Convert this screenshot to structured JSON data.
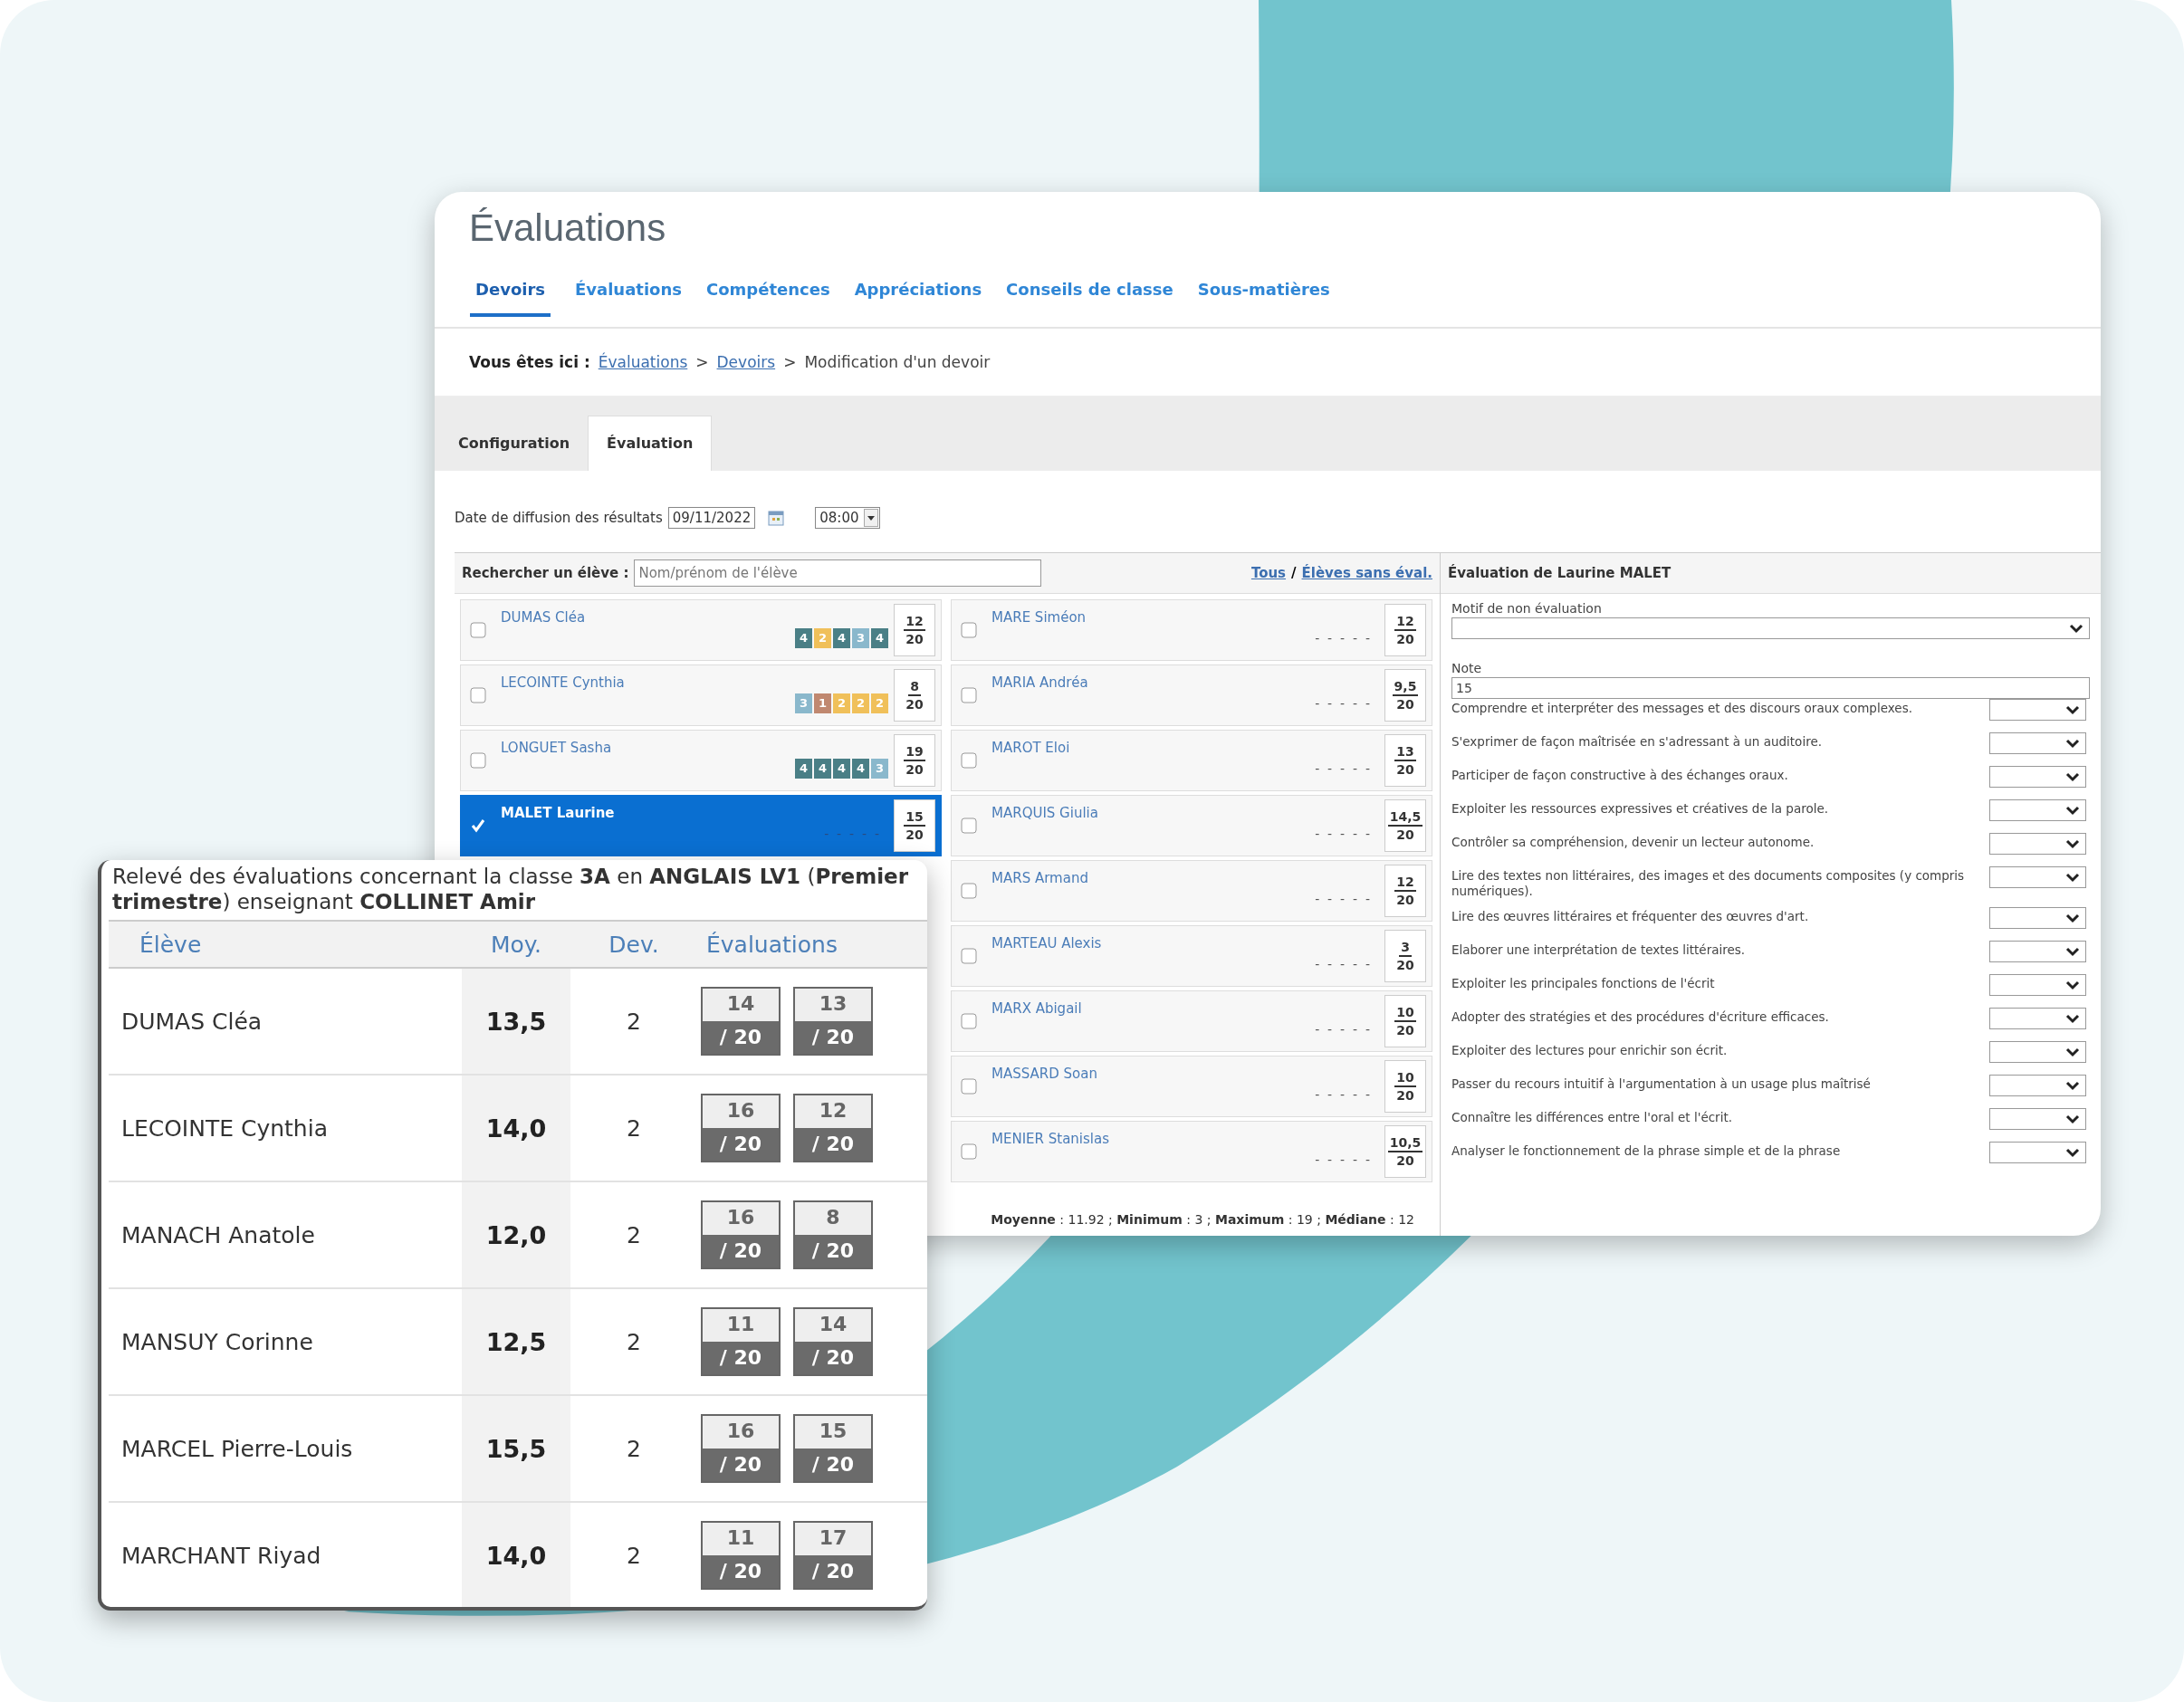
{
  "main_window": {
    "title": "Évaluations",
    "tabs": [
      {
        "label": "Devoirs",
        "selected": true
      },
      {
        "label": "Évaluations",
        "selected": false
      },
      {
        "label": "Compétences",
        "selected": false
      },
      {
        "label": "Appréciations",
        "selected": false
      },
      {
        "label": "Conseils de classe",
        "selected": false
      },
      {
        "label": "Sous-matières",
        "selected": false
      }
    ],
    "breadcrumb": {
      "label": "Vous êtes ici :",
      "items": [
        {
          "text": "Évaluations",
          "kind": "link"
        },
        {
          "text": ">",
          "kind": "separator"
        },
        {
          "text": "Devoirs",
          "kind": "link"
        },
        {
          "text": ">",
          "kind": "separator"
        },
        {
          "text": "Modification d'un devoir",
          "kind": "current"
        }
      ]
    },
    "subtabs": [
      {
        "label": "Configuration",
        "selected": false
      },
      {
        "label": "Évaluation",
        "selected": true
      }
    ],
    "date_row": {
      "label": "Date de diffusion des résultats",
      "date": "09/11/2022",
      "time": "08:00"
    },
    "search": {
      "label": "Rechercher un élève :",
      "placeholder": "Nom/prénom de l'élève",
      "filters": [
        "Tous",
        "Élèves sans éval."
      ],
      "filter_separator": "/"
    },
    "students_left": [
      {
        "name": "DUMAS Cléa",
        "checked": false,
        "selected": false,
        "skills": [
          {
            "value": "4",
            "color": "#4a7f86"
          },
          {
            "value": "2",
            "color": "#f0c05a"
          },
          {
            "value": "4",
            "color": "#4a7f86"
          },
          {
            "value": "3",
            "color": "#8ab8cc"
          },
          {
            "value": "4",
            "color": "#4a7f86"
          }
        ],
        "grade": "12",
        "total": "20"
      },
      {
        "name": "LECOINTE Cynthia",
        "checked": false,
        "selected": false,
        "skills": [
          {
            "value": "3",
            "color": "#8ab8cc"
          },
          {
            "value": "1",
            "color": "#c08870"
          },
          {
            "value": "2",
            "color": "#f0c05a"
          },
          {
            "value": "2",
            "color": "#f0c05a"
          },
          {
            "value": "2",
            "color": "#f0c05a"
          }
        ],
        "grade": "8",
        "total": "20"
      },
      {
        "name": "LONGUET Sasha",
        "checked": false,
        "selected": false,
        "skills": [
          {
            "value": "4",
            "color": "#4a7f86"
          },
          {
            "value": "4",
            "color": "#4a7f86"
          },
          {
            "value": "4",
            "color": "#4a7f86"
          },
          {
            "value": "4",
            "color": "#4a7f86"
          },
          {
            "value": "3",
            "color": "#8ab8cc"
          }
        ],
        "grade": "19",
        "total": "20"
      },
      {
        "name": "MALET Laurine",
        "checked": true,
        "selected": true,
        "marks": "-  -  -  -  -",
        "grade": "15",
        "total": "20"
      }
    ],
    "students_right": [
      {
        "name": "MARE Siméon",
        "checked": false,
        "selected": false,
        "marks": "-  -  -  -  -",
        "grade": "12",
        "total": "20"
      },
      {
        "name": "MARIA Andréa",
        "checked": false,
        "selected": false,
        "marks": "-  -  -  -  -",
        "grade": "9,5",
        "total": "20"
      },
      {
        "name": "MAROT Eloi",
        "checked": false,
        "selected": false,
        "marks": "-  -  -  -  -",
        "grade": "13",
        "total": "20"
      },
      {
        "name": "MARQUIS Giulia",
        "checked": false,
        "selected": false,
        "marks": "-  -  -  -  -",
        "grade": "14,5",
        "total": "20"
      },
      {
        "name": "MARS Armand",
        "checked": false,
        "selected": false,
        "marks": "-  -  -  -  -",
        "grade": "12",
        "total": "20"
      },
      {
        "name": "MARTEAU Alexis",
        "checked": false,
        "selected": false,
        "marks": "-  -  -  -  -",
        "grade": "3",
        "total": "20"
      },
      {
        "name": "MARX Abigail",
        "checked": false,
        "selected": false,
        "marks": "-  -  -  -  -",
        "grade": "10",
        "total": "20"
      },
      {
        "name": "MASSARD Soan",
        "checked": false,
        "selected": false,
        "marks": "-  -  -  -  -",
        "grade": "10",
        "total": "20"
      },
      {
        "name": "MENIER Stanislas",
        "checked": false,
        "selected": false,
        "marks": "-  -  -  -  -",
        "grade": "10,5",
        "total": "20"
      }
    ],
    "stats": "**Moyenne** : 11.92 ; **Minimum** : 3 ; **Maximum** : 19 ; **Médiane** : 12",
    "panel": {
      "title": "Évaluation de Laurine MALET",
      "motif_label": "Motif de non évaluation",
      "note_label": "Note",
      "note_value": "15",
      "competences": [
        "Comprendre et interpréter des messages et des discours oraux complexes.",
        "S'exprimer de façon maîtrisée en s'adressant à un auditoire.",
        "Participer de façon constructive à des échanges oraux.",
        "Exploiter les ressources expressives et créatives de la parole.",
        "Contrôler sa compréhension, devenir un lecteur autonome.",
        "Lire des textes non littéraires, des images et des documents composites (y compris numériques).",
        "Lire des œuvres littéraires et fréquenter des œuvres d'art.",
        "Elaborer une interprétation de textes littéraires.",
        "Exploiter les principales fonctions de l'écrit",
        "Adopter des stratégies et des procédures d'écriture efficaces.",
        "Exploiter des lectures pour enrichir son écrit.",
        "Passer du recours intuitif à l'argumentation à un usage plus maîtrisé",
        "Connaître les différences entre l'oral et l'écrit.",
        "Analyser le fonctionnement de la phrase simple et de la phrase"
      ]
    }
  },
  "report": {
    "title": "Relevé des évaluations concernant la classe **3A** en **ANGLAIS LV1** (**Premier trimestre**) enseignant **COLLINET Amir**",
    "columns": [
      "Élève",
      "Moy.",
      "Dev.",
      "Évaluations"
    ],
    "rows": [
      {
        "name": "DUMAS Cléa",
        "average": "13,5",
        "count": "2",
        "grades": [
          {
            "score": "14",
            "total": "/ 20"
          },
          {
            "score": "13",
            "total": "/ 20"
          }
        ]
      },
      {
        "name": "LECOINTE Cynthia",
        "average": "14,0",
        "count": "2",
        "grades": [
          {
            "score": "16",
            "total": "/ 20"
          },
          {
            "score": "12",
            "total": "/ 20"
          }
        ]
      },
      {
        "name": "MANACH Anatole",
        "average": "12,0",
        "count": "2",
        "grades": [
          {
            "score": "16",
            "total": "/ 20"
          },
          {
            "score": "8",
            "total": "/ 20"
          }
        ]
      },
      {
        "name": "MANSUY Corinne",
        "average": "12,5",
        "count": "2",
        "grades": [
          {
            "score": "11",
            "total": "/ 20"
          },
          {
            "score": "14",
            "total": "/ 20"
          }
        ]
      },
      {
        "name": "MARCEL Pierre-Louis",
        "average": "15,5",
        "count": "2",
        "grades": [
          {
            "score": "16",
            "total": "/ 20"
          },
          {
            "score": "15",
            "total": "/ 20"
          }
        ]
      },
      {
        "name": "MARCHANT Riyad",
        "average": "14,0",
        "count": "2",
        "grades": [
          {
            "score": "11",
            "total": "/ 20"
          },
          {
            "score": "17",
            "total": "/ 20"
          }
        ]
      }
    ]
  }
}
